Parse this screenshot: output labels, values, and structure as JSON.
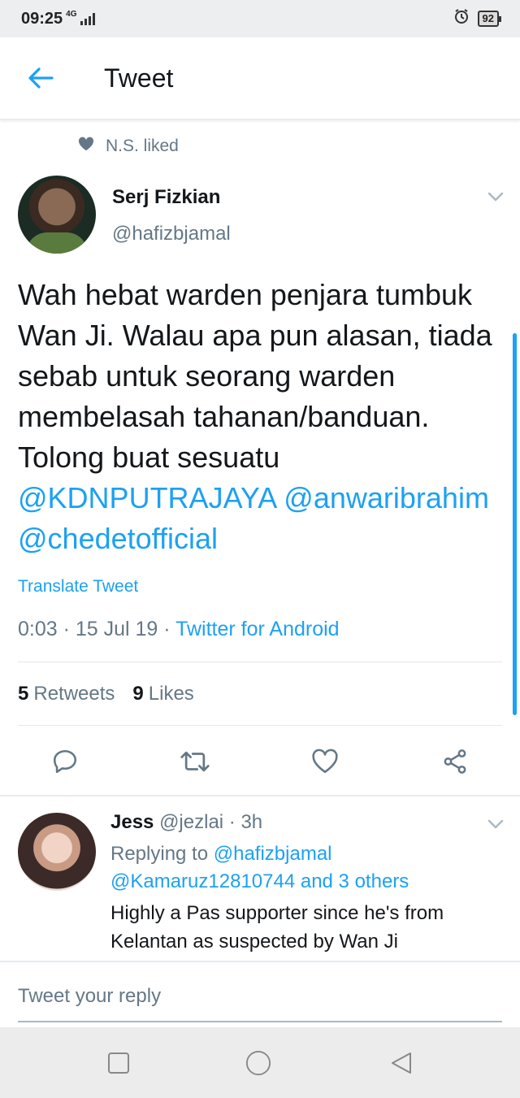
{
  "status_bar": {
    "time": "09:25",
    "network": "4G",
    "battery": "92"
  },
  "app_bar": {
    "title": "Tweet"
  },
  "social_context": {
    "text": "N.S. liked"
  },
  "tweet": {
    "author_name": "Serj Fizkian",
    "author_handle": "@hafizbjamal",
    "text_plain": "Wah hebat warden penjara tumbuk Wan Ji. Walau apa pun alasan, tiada sebab untuk seorang warden membelasah tahanan/banduan. Tolong buat sesuatu",
    "mention_1": "@KDNPUTRAJAYA",
    "mention_2": "@anwaribrahim",
    "mention_3": "@chedetofficial",
    "translate_label": "Translate Tweet",
    "timestamp": "0:03 · 15 Jul 19 · ",
    "source": "Twitter for Android",
    "retweet_count": "5",
    "retweet_label": "Retweets",
    "like_count": "9",
    "like_label": "Likes"
  },
  "reply": {
    "author_name": "Jess",
    "author_handle": "@jezlai",
    "time": " · 3h",
    "replying_prefix": "Replying to ",
    "replying_user": "@hafizbjamal",
    "replying_more": "@Kamaruz12810744 and 3 others",
    "text": "Highly a Pas supporter since he's from Kelantan  as suspected by Wan Ji"
  },
  "composer": {
    "placeholder": "Tweet your reply"
  },
  "colors": {
    "accent": "#1da1f2",
    "text": "#14171a",
    "secondary": "#657786"
  }
}
